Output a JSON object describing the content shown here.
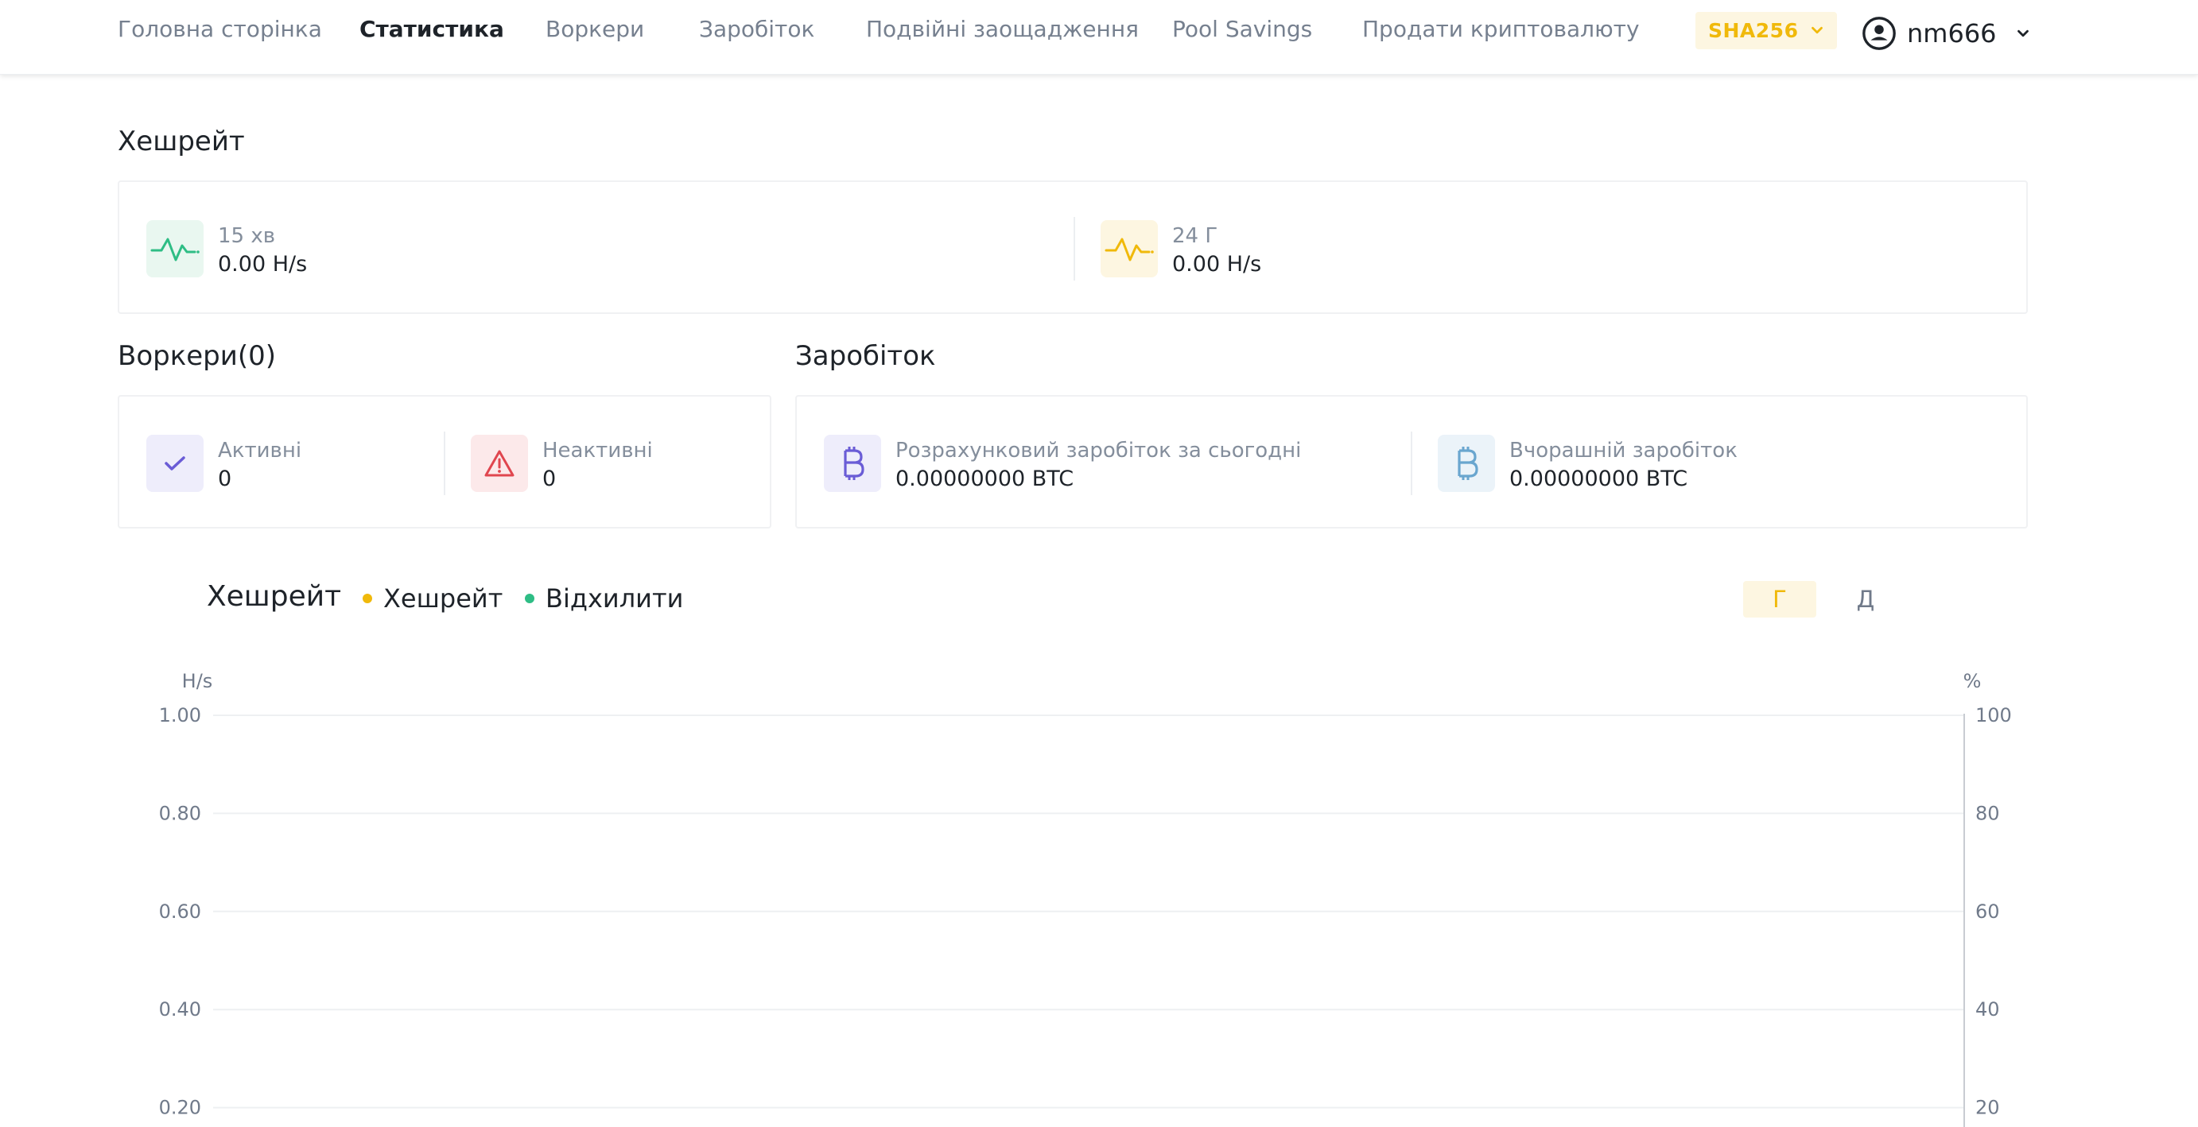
{
  "nav": {
    "items": [
      {
        "label": "Головна сторінка",
        "active": false
      },
      {
        "label": "Статистика",
        "active": true
      },
      {
        "label": "Воркери",
        "active": false
      },
      {
        "label": "Заробіток",
        "active": false
      },
      {
        "label": "Подвійні заощадження",
        "active": false
      },
      {
        "label": "Pool Savings",
        "active": false
      },
      {
        "label": "Продати криптовалюту",
        "active": false
      }
    ],
    "algorithm": "SHA256",
    "username": "nm666"
  },
  "hashrate": {
    "title": "Хешрейт",
    "stats": [
      {
        "label": "15 хв",
        "value": "0.00 H/s",
        "icon": "pulse-icon",
        "color": "#2ebd85"
      },
      {
        "label": "24 Г",
        "value": "0.00 H/s",
        "icon": "pulse-icon",
        "color": "#f0b90b"
      }
    ]
  },
  "workers": {
    "title": "Воркери(0)",
    "active_label": "Активні",
    "active_value": "0",
    "inactive_label": "Неактивні",
    "inactive_value": "0"
  },
  "earnings": {
    "title": "Заробіток",
    "today_label": "Розрахунковий заробіток за сьогодні",
    "today_value": "0.00000000 BTC",
    "yesterday_label": "Вчорашній заробіток",
    "yesterday_value": "0.00000000 BTC"
  },
  "chart": {
    "title": "Хешрейт",
    "legend": [
      {
        "name": "Хешрейт",
        "color": "#f0b90b"
      },
      {
        "name": "Відхилити",
        "color": "#2ebd85"
      }
    ],
    "ranges": [
      {
        "label": "Г",
        "active": true
      },
      {
        "label": "Д",
        "active": false
      }
    ]
  },
  "chart_data": {
    "type": "line",
    "title": "",
    "ylabel": "H/s",
    "y2label": "%",
    "ylim": [
      0,
      1
    ],
    "y2lim": [
      0,
      100
    ],
    "yticks": [
      "1.00",
      "0.80",
      "0.60",
      "0.40",
      "0.20"
    ],
    "y2ticks": [
      "100",
      "80",
      "60",
      "40",
      "20"
    ],
    "grid": true,
    "series": [
      {
        "name": "Хешрейт",
        "values": []
      },
      {
        "name": "Відхилити",
        "values": []
      }
    ]
  }
}
